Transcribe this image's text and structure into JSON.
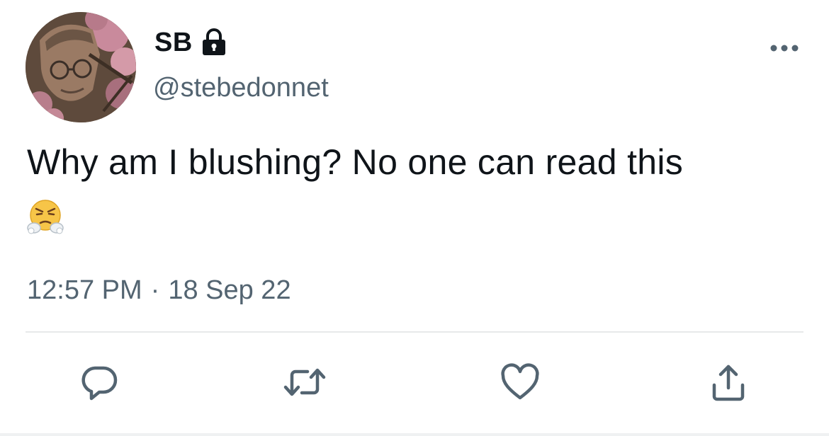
{
  "tweet": {
    "display_name": "SB",
    "handle": "@stebedonnet",
    "text": "Why am I blushing? No one can read this",
    "emoji": "face-with-steam-from-nose",
    "time": "12:57 PM",
    "separator": "·",
    "date": "18 Sep 22"
  },
  "icons": {
    "protected": "lock-icon",
    "more": "more-icon",
    "reply": "reply-icon",
    "retweet": "retweet-icon",
    "like": "heart-icon",
    "share": "share-icon"
  },
  "colors": {
    "text_primary": "#0f1419",
    "text_secondary": "#536471",
    "divider": "#e7e9ea"
  }
}
